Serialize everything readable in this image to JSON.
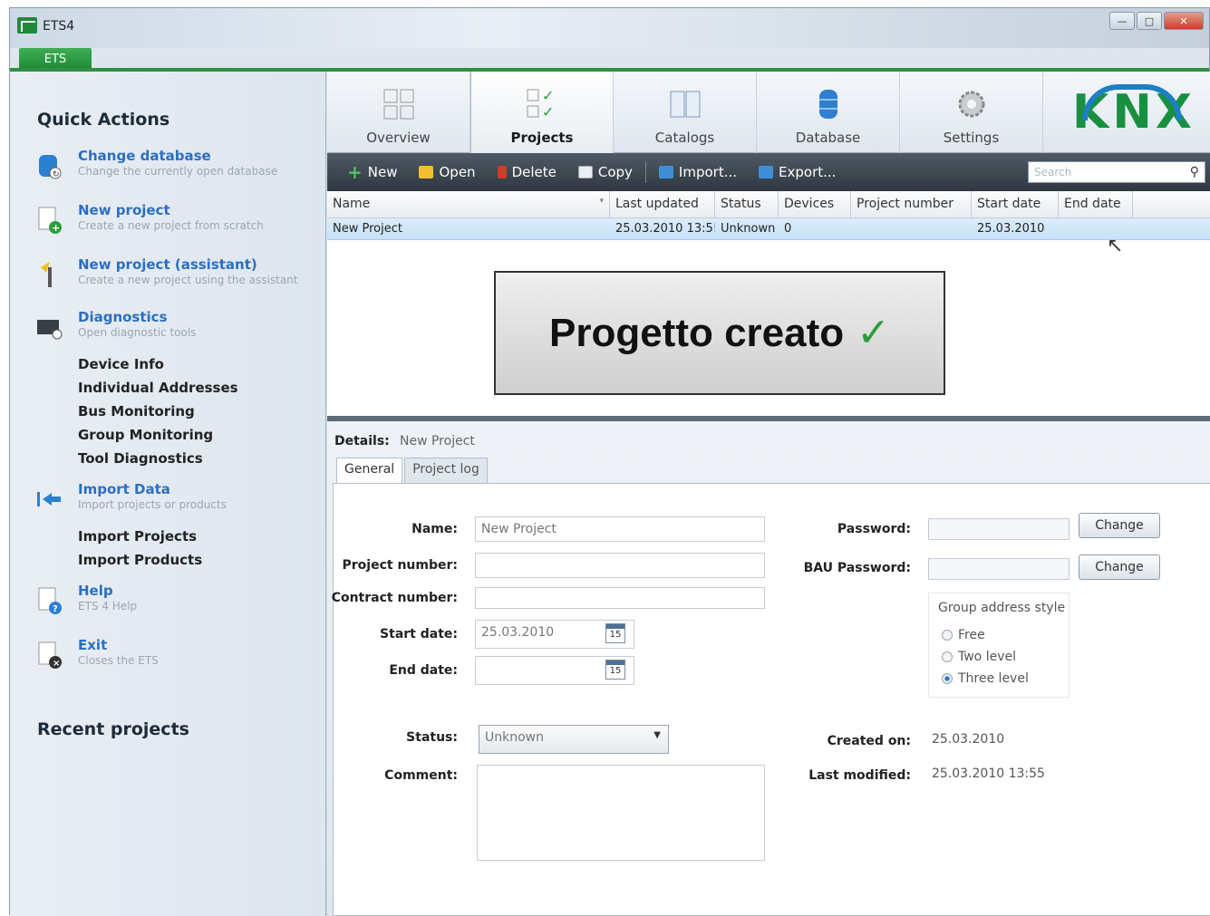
{
  "window": {
    "title": "ETS4",
    "ribbon_tab": "ETS"
  },
  "quick_actions": {
    "title": "Quick Actions",
    "items": [
      {
        "title": "Change database",
        "desc": "Change the currently open database"
      },
      {
        "title": "New project",
        "desc": "Create a new project from scratch"
      },
      {
        "title": "New project (assistant)",
        "desc": "Create a new project using the assistant"
      },
      {
        "title": "Diagnostics",
        "desc": "Open diagnostic tools"
      },
      {
        "title": "Import Data",
        "desc": "Import projects or products"
      },
      {
        "title": "Help",
        "desc": "ETS 4 Help"
      },
      {
        "title": "Exit",
        "desc": "Closes the ETS"
      }
    ],
    "diagnostics_sub": [
      "Device Info",
      "Individual Addresses",
      "Bus Monitoring",
      "Group Monitoring",
      "Tool Diagnostics"
    ],
    "import_sub": [
      "Import Projects",
      "Import Products"
    ],
    "recent_title": "Recent projects"
  },
  "nav": {
    "items": [
      "Overview",
      "Projects",
      "Catalogs",
      "Database",
      "Settings"
    ],
    "logo": "KNX"
  },
  "actions": {
    "items": [
      "New",
      "Open",
      "Delete",
      "Copy",
      "Import...",
      "Export..."
    ],
    "search_placeholder": "Search"
  },
  "table": {
    "columns": [
      "Name",
      "Last updated",
      "Status",
      "Devices",
      "Project number",
      "Start date",
      "End date"
    ],
    "rows": [
      {
        "name": "New Project",
        "last_updated": "25.03.2010 13:5!",
        "status": "Unknown",
        "devices": "0",
        "project_number": "",
        "start_date": "25.03.2010",
        "end_date": ""
      }
    ]
  },
  "overlay": {
    "text": "Progetto creato",
    "check": "✓"
  },
  "details": {
    "label": "Details:",
    "value": "New Project",
    "tabs": [
      "General",
      "Project log"
    ],
    "fields": {
      "name_label": "Name:",
      "name_value": "New Project",
      "project_number_label": "Project number:",
      "contract_number_label": "Contract number:",
      "start_date_label": "Start date:",
      "start_date_value": "25.03.2010",
      "end_date_label": "End date:",
      "calendar_day": "15",
      "status_label": "Status:",
      "status_value": "Unknown",
      "comment_label": "Comment:",
      "password_label": "Password:",
      "bau_password_label": "BAU Password:",
      "change_label": "Change",
      "group_style_title": "Group address style",
      "group_options": [
        "Free",
        "Two level",
        "Three level"
      ],
      "created_on_label": "Created on:",
      "created_on_value": "25.03.2010",
      "last_modified_label": "Last modified:",
      "last_modified_value": "25.03.2010 13:55"
    }
  }
}
